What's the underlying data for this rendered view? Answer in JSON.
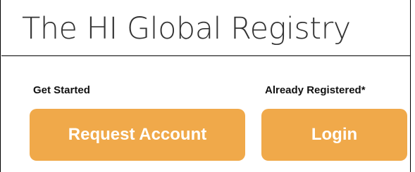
{
  "header": {
    "title": "The HI Global Registry"
  },
  "get_started": {
    "label": "Get Started",
    "button_label": "Request Account"
  },
  "registered": {
    "label": "Already Registered*",
    "button_label": "Login"
  },
  "colors": {
    "button_background": "#f0a94a",
    "button_text": "#ffffff",
    "title_text": "#333333"
  }
}
